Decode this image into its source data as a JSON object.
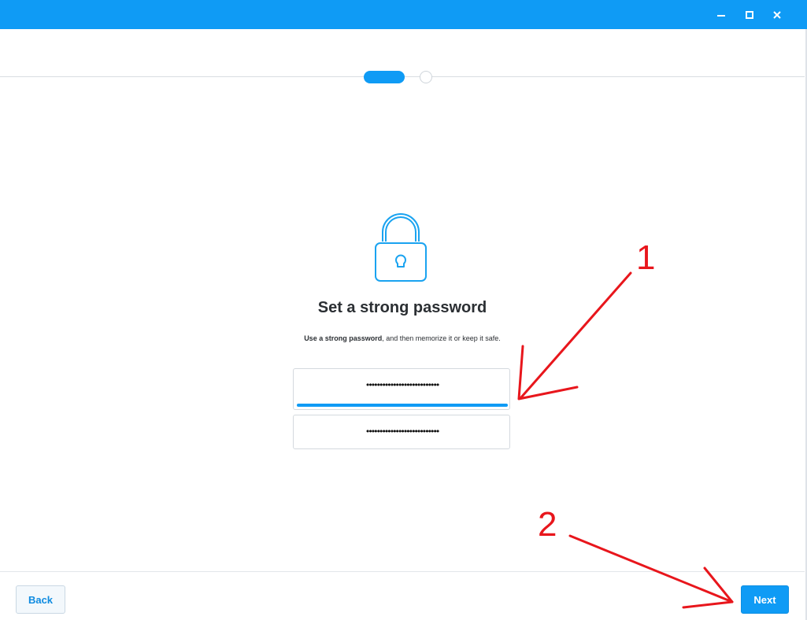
{
  "window": {
    "controls": {
      "minimize_icon": "minimize-icon",
      "maximize_icon": "maximize-icon",
      "close_icon": "close-icon"
    }
  },
  "steps": {
    "total": 2,
    "current": 1
  },
  "content": {
    "icon": "lock-icon",
    "heading": "Set a strong password",
    "subtext_bold": "Use a strong password",
    "subtext_rest": ", and then memorize it or keep it safe."
  },
  "password_field": {
    "masked_value": "•••••••••••••••••••••••••••",
    "strength_fraction": 1.0
  },
  "confirm_field": {
    "masked_value": "•••••••••••••••••••••••••••"
  },
  "footer": {
    "back_label": "Back",
    "next_label": "Next"
  },
  "annotations": {
    "label_1": "1",
    "label_2": "2",
    "color": "#e8161c"
  },
  "colors": {
    "accent": "#0f9bf5",
    "text": "#2b2f33"
  }
}
